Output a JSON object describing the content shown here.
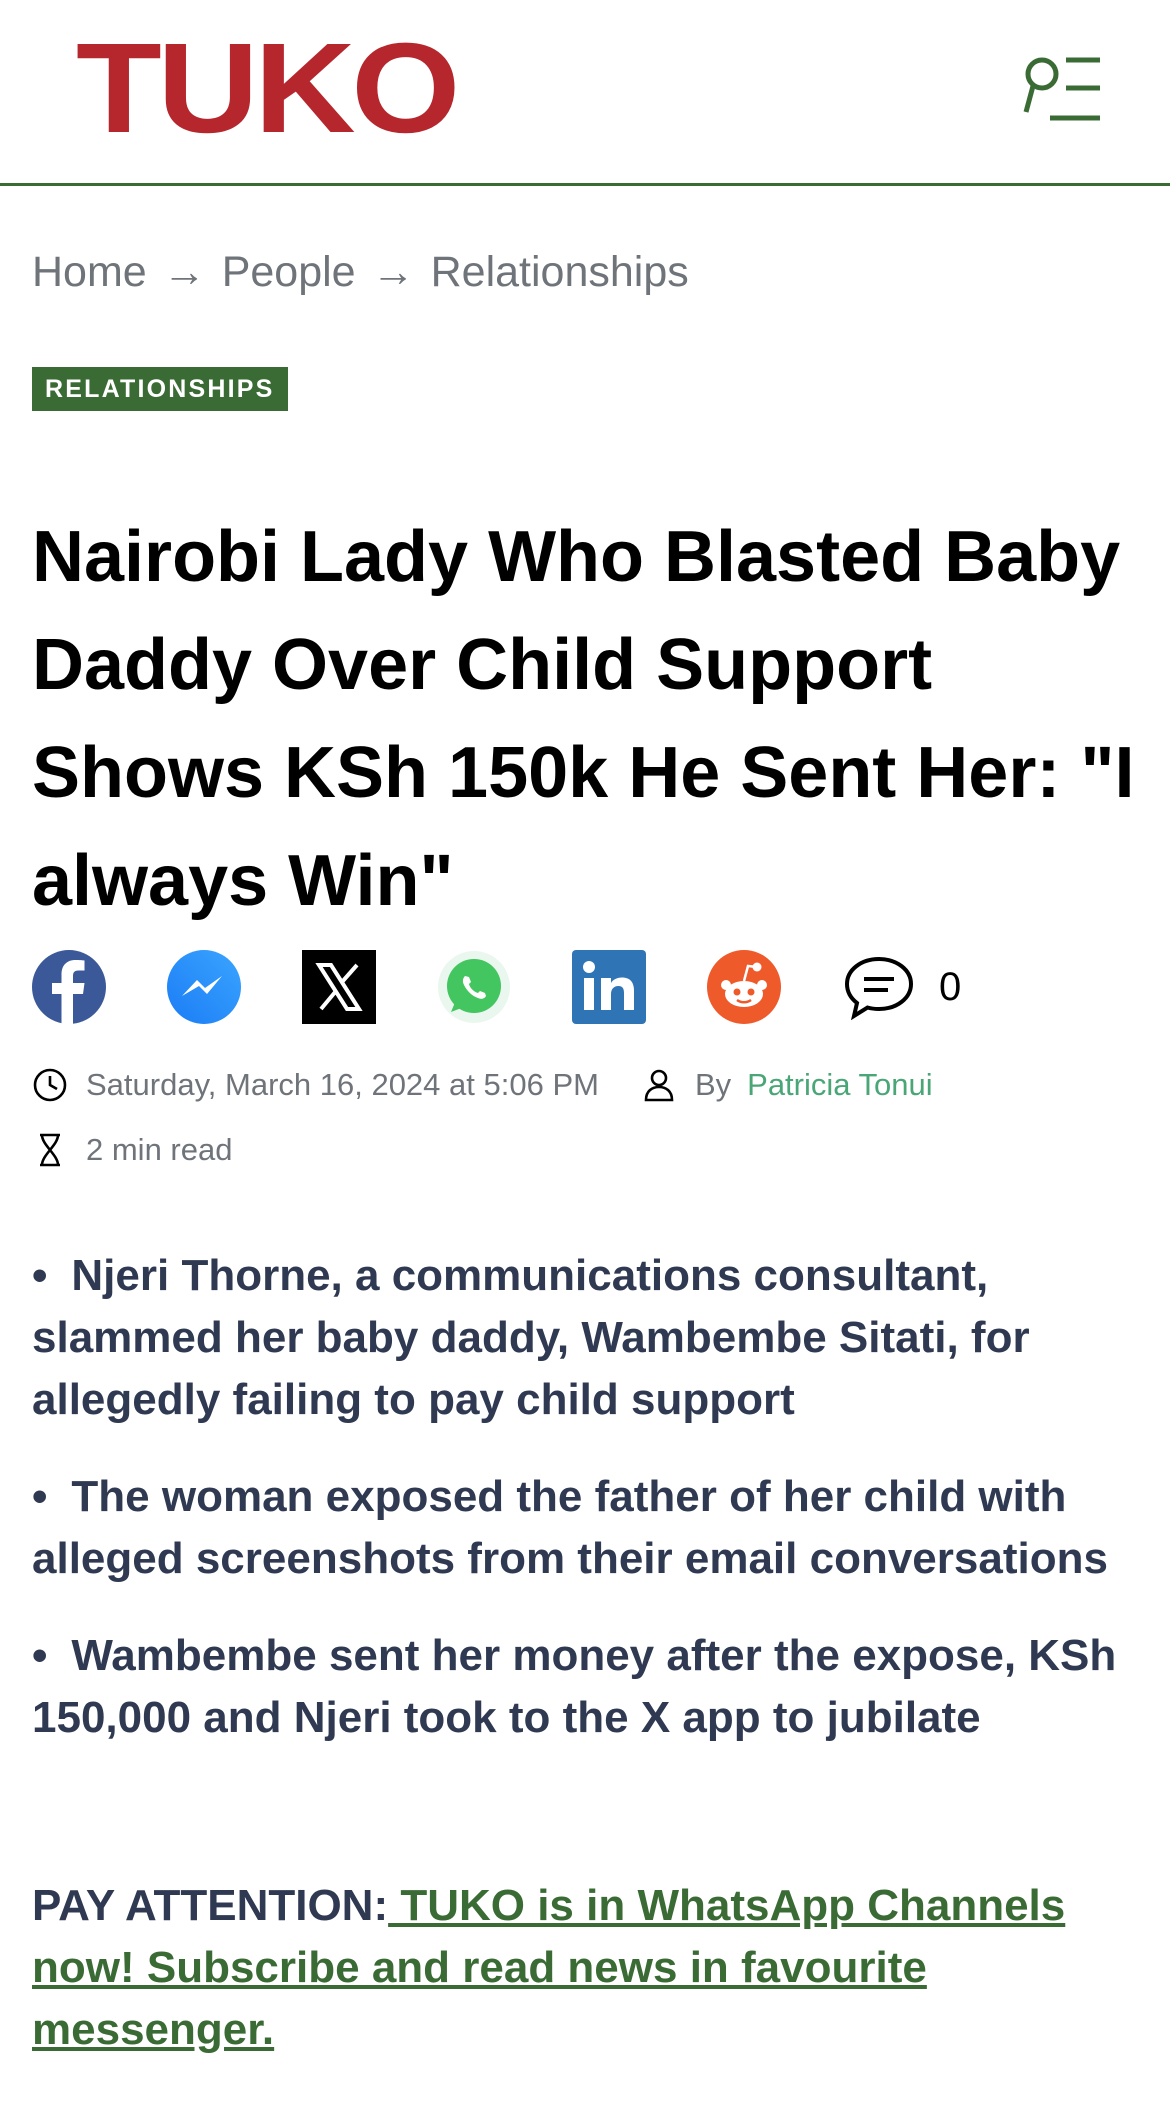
{
  "header": {
    "logo_text": "TUKO",
    "brand_color": "#b6262d",
    "accent_color": "#3b6b35",
    "menu_icon": "search-menu-icon"
  },
  "breadcrumb": {
    "items": [
      "Home",
      "People",
      "Relationships"
    ],
    "separator": "→"
  },
  "category": "RELATIONSHIPS",
  "article": {
    "title": "Nairobi Lady Who Blasted Baby Daddy Over Child Sup­port Shows KSh 150k He Sent Her: \"I always Win\"",
    "comment_count": "0",
    "date": "Saturday, March 16, 2024 at 5:06 PM",
    "by": "By",
    "author": "Patricia Tonui",
    "read_time": "2 min read"
  },
  "share": [
    "facebook-icon",
    "messenger-icon",
    "x-icon",
    "whatsapp-icon",
    "linkedin-icon",
    "reddit-icon",
    "comment-icon"
  ],
  "highlights": [
    "Njeri Thorne, a communications consultant, slammed her baby daddy, Wambembe Sitati, for allegedly failing to pay child support",
    "The woman exposed the father of her child with alleged screenshots from their email conversa­tions",
    "Wambembe sent her money after the expose, KSh 150,000 and Njeri took to the X app to jubilate"
  ],
  "pay_attention": {
    "label": "PAY ATTENTION:",
    "link_text": " TUKO is in WhatsApp Chan­nels now! Subscribe and read news in favourite messenger."
  }
}
